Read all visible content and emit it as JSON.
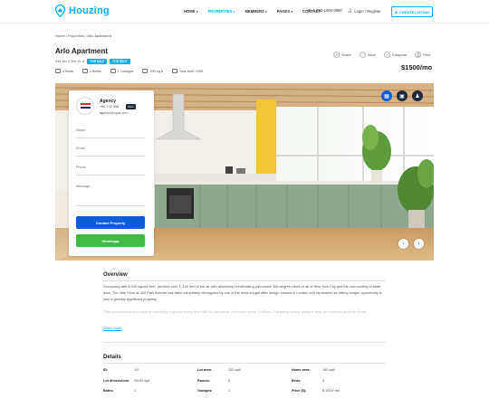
{
  "brand": {
    "name": "Houzing",
    "accent": "#00AEFF"
  },
  "nav": [
    {
      "label": "HOME",
      "active": false,
      "dropdown": true
    },
    {
      "label": "PROPERTIES",
      "active": true,
      "dropdown": true
    },
    {
      "label": "MEMBERS",
      "active": false,
      "dropdown": true
    },
    {
      "label": "PAGES",
      "active": false,
      "dropdown": true
    },
    {
      "label": "CONTACT",
      "active": false,
      "dropdown": false
    }
  ],
  "header": {
    "phone": "1-392-1000-0900",
    "login_label": "Login / Register",
    "create_label": "CREATE LISTING"
  },
  "breadcrumb": "Home  /  Properties  /  Arlo Apartment",
  "property": {
    "title": "Arlo Apartment",
    "address": "336 4th 2 The St. 6",
    "badges": [
      "FOR SALE",
      "FOR RENT"
    ],
    "price": "$1500/mo",
    "features": [
      "4 Beds",
      "1 Baths",
      "1 Garages",
      "200 sq ft",
      "Year built: 1995"
    ]
  },
  "actions": [
    "Share",
    "Save",
    "Compare",
    "Print"
  ],
  "agent": {
    "name": "Agency",
    "phone": "+66 132 456",
    "email": "agency@spar.com",
    "more_label": "More"
  },
  "form": {
    "fields": [
      "Name",
      "Email",
      "Phone",
      "Message"
    ],
    "contact_label": "Contact Property",
    "whatsapp_label": "Whatsapp",
    "colors": {
      "contact": "#0E5DD6",
      "whatsapp": "#40BC45"
    }
  },
  "hero_buttons": {
    "prev": "‹",
    "next": "›"
  },
  "overview": {
    "title": "Overview",
    "paragraph": "Occupying well 6,000 square feet, perches over 1, 100 feet in the air with absolutely breathtaking panoramic 360-degree views of all of New York City and the surrounding tri-state area. The 45th Floor at 432 Park Avenue has been completely reimagined by one of the most sought after design houses in London and represents an utterly unique opportunity to own a globally significant property.",
    "faded": "This condominium is a place of tranquility. It graces every floor with its panorama, 3 elevator cores, 3 offices, 3 showing rooms, eastern view, an excellent air in the North.",
    "show_more": "Show more"
  },
  "details": {
    "title": "Details",
    "rows": [
      [
        {
          "k": "ID:",
          "v": "1/2"
        },
        {
          "k": "Lot area:",
          "v": "250 sqft"
        },
        {
          "k": "Home area:",
          "v": "180 sqft"
        }
      ],
      [
        {
          "k": "Lot dimensions:",
          "v": "20x30 sqft"
        },
        {
          "k": "Rooms:",
          "v": "6"
        },
        {
          "k": "Beds:",
          "v": "4"
        }
      ],
      [
        {
          "k": "Baths:",
          "v": "1"
        },
        {
          "k": "Garages:",
          "v": "1"
        },
        {
          "k": "Price ($):",
          "v": "$ 1500/ mo"
        }
      ]
    ]
  }
}
